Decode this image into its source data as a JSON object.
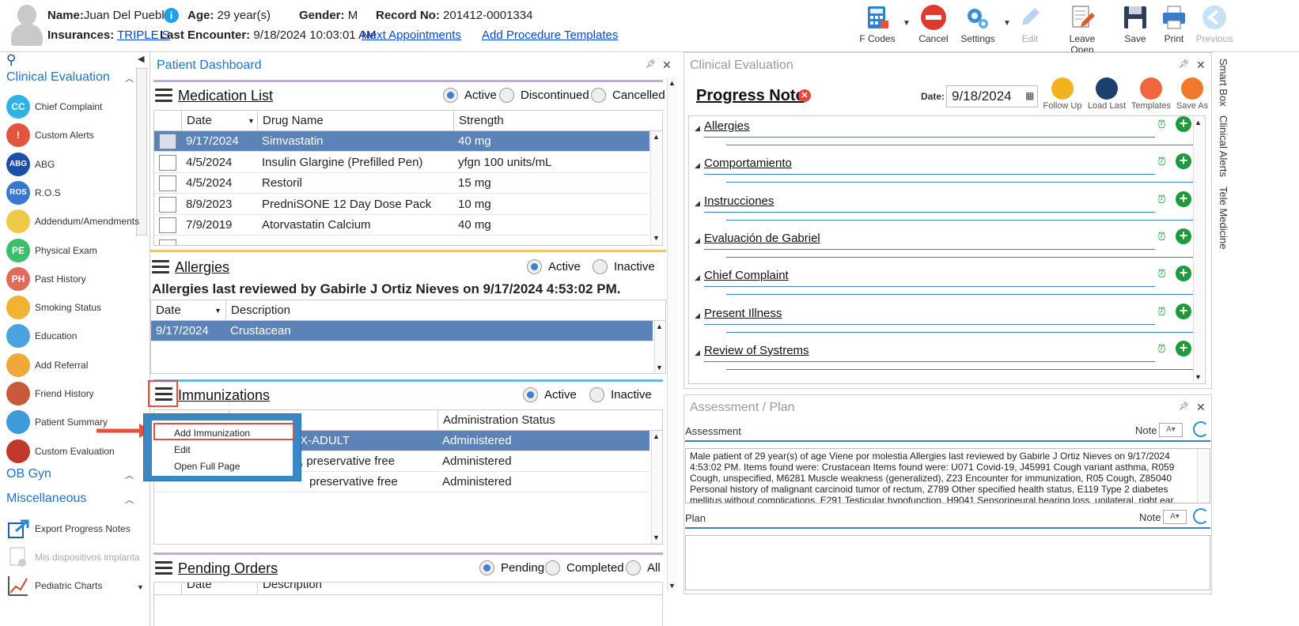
{
  "header": {
    "name_label": "Name:",
    "name_value": "Juan Del Pueblo",
    "age_label": "Age:",
    "age_value": "29 year(s)",
    "gender_label": "Gender:",
    "gender_value": "M",
    "record_label": "Record No:",
    "record_value": "201412-0001334",
    "insurances_label": "Insurances:",
    "insurances_value": "TRIPLE S",
    "last_encounter_label": "Last Encounter:",
    "last_encounter_value": "9/18/2024 10:03:01 AM",
    "next_appointments": "Next Appointments",
    "add_procedure_templates": "Add Procedure Templates"
  },
  "toolbar": {
    "fcodes": "F Codes",
    "cancel": "Cancel",
    "settings": "Settings",
    "edit": "Edit",
    "leave_open": "Leave Open",
    "save": "Save",
    "print": "Print",
    "previous": "Previous"
  },
  "sidebar": {
    "section1": "Clinical Evaluation",
    "section2": "OB Gyn",
    "section3": "Miscellaneous",
    "items": [
      {
        "label": "Chief Complaint",
        "abbr": "CC",
        "color": "#2fb3e6"
      },
      {
        "label": "Custom Alerts",
        "abbr": "!",
        "color": "#e2553f"
      },
      {
        "label": "ABG",
        "abbr": "ABG",
        "color": "#1d4fa8"
      },
      {
        "label": "R.O.S",
        "abbr": "ROS",
        "color": "#3a78d0"
      },
      {
        "label": "Addendum/Amendments",
        "abbr": "",
        "color": "#f0c94a"
      },
      {
        "label": "Physical Exam",
        "abbr": "PE",
        "color": "#3bbf6a"
      },
      {
        "label": "Past History",
        "abbr": "PH",
        "color": "#e26a5b"
      },
      {
        "label": "Smoking Status",
        "abbr": "",
        "color": "#f2b233"
      },
      {
        "label": "Education",
        "abbr": "",
        "color": "#4aa2e0"
      },
      {
        "label": "Add Referral",
        "abbr": "",
        "color": "#f0a83a"
      },
      {
        "label": "Friend History",
        "abbr": "",
        "color": "#c75a3a"
      },
      {
        "label": "Patient Summary",
        "abbr": "",
        "color": "#3f9ad8"
      },
      {
        "label": "Custom Evaluation",
        "abbr": "",
        "color": "#c0392b"
      }
    ],
    "misc_items": [
      {
        "label": "Export Progress Notes"
      },
      {
        "label": "Mis dispositivos implanta"
      },
      {
        "label": "Pediatric Charts"
      }
    ]
  },
  "dashboard": {
    "title": "Patient Dashboard",
    "medication": {
      "title": "Medication List",
      "radios": [
        "Active",
        "Discontinued",
        "Cancelled"
      ],
      "columns": [
        "Date",
        "Drug Name",
        "Strength"
      ],
      "rows": [
        [
          "9/17/2024",
          "Simvastatin",
          "40 mg"
        ],
        [
          "4/5/2024",
          "Insulin Glargine (Prefilled Pen)",
          "yfgn 100 units/mL"
        ],
        [
          "4/5/2024",
          "Restoril",
          "15 mg"
        ],
        [
          "8/9/2023",
          "PredniSONE 12 Day Dose Pack",
          "10 mg"
        ],
        [
          "7/9/2019",
          "Atorvastatin Calcium",
          "40 mg"
        ]
      ]
    },
    "allergies": {
      "title": "Allergies",
      "radios": [
        "Active",
        "Inactive"
      ],
      "reviewed": "Allergies last reviewed by Gabirle J Ortiz Nieves on 9/17/2024 4:53:02 PM.",
      "columns": [
        "Date",
        "Description"
      ],
      "rows": [
        [
          "9/17/2024",
          "Crustacean"
        ]
      ]
    },
    "immunizations": {
      "title": "Immunizations",
      "radios": [
        "Active",
        "Inactive"
      ],
      "columns": [
        "Administration Status"
      ],
      "rows": [
        [
          "X-ADULT",
          "Administered"
        ],
        [
          ", preservative free",
          "Administered"
        ],
        [
          "preservative free",
          "Administered"
        ]
      ]
    },
    "pending": {
      "title": "Pending Orders",
      "radios": [
        "Pending",
        "Completed",
        "All"
      ],
      "columns": [
        "Date",
        "Description"
      ]
    }
  },
  "context_menu": {
    "items": [
      "Add Immunization",
      "Edit",
      "Open Full Page"
    ]
  },
  "clinical_eval": {
    "title": "Clinical Evaluation",
    "note_title": "Progress Note",
    "date_label": "Date:",
    "date_value": "9/18/2024",
    "buttons": [
      "Follow Up",
      "Load Last",
      "Templates",
      "Save As"
    ],
    "sections": [
      "Allergies",
      "Comportamiento",
      "Instrucciones",
      "Evaluación de Gabriel",
      "Chief Complaint",
      "Present Illness",
      "Review of Systrems"
    ]
  },
  "assessment_plan": {
    "title": "Assessment / Plan",
    "assessment_label": "Assessment",
    "note_label": "Note",
    "plan_label": "Plan",
    "assessment_text": "Male patient of 29 year(s) of age Viene por molestia     Allergies last reviewed by Gabirle J Ortiz Nieves on 9/17/2024 4:53:02 PM.    Items found were:  Crustacean  Items found were:  U071 Covid-19, J45991 Cough variant asthma, R059 Cough, unspecified, M6281 Muscle weakness (generalized), Z23 Encounter for immunization, R05 Cough, Z85040 Personal history of malignant carcinoid tumor of rectum, Z789 Other specified health status, E119 Type 2 diabetes mellitus without complications, E291 Testicular hypofunction, H9041 Sensorineural hearing loss, unilateral, right ear, with"
  },
  "right_tabs": [
    "Smart Box",
    "Clinical Alerts",
    "Tele Medicine"
  ]
}
